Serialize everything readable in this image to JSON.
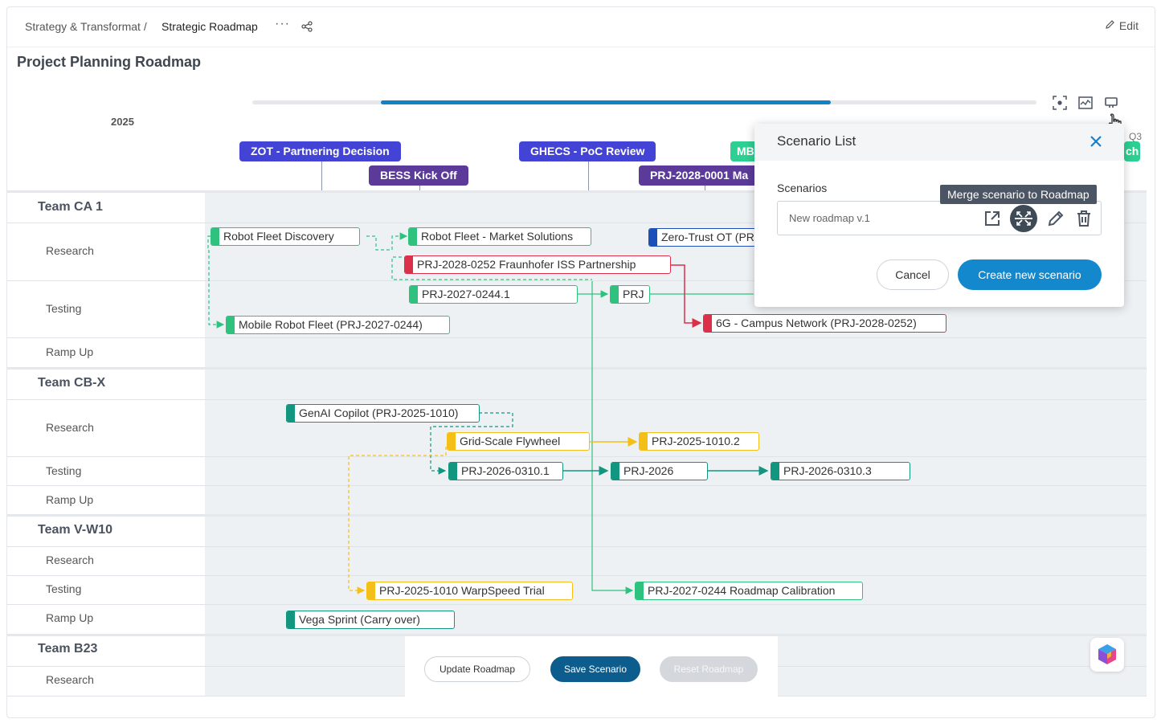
{
  "header": {
    "breadcrumb_parent": "Strategy & Transformat /",
    "breadcrumb_current": "Strategic Roadmap",
    "more_label": "···",
    "edit_label": "Edit"
  },
  "page_title": "Project Planning Roadmap",
  "timeline": {
    "year": "2025",
    "quarter_label": "Q3",
    "range_start_fraction": 0.16,
    "range_end_fraction": 0.737
  },
  "milestones": [
    {
      "label": "ZOT - Partnering Decision",
      "color": "#4343d6"
    },
    {
      "label": "BESS Kick Off",
      "color": "#5b3a9a"
    },
    {
      "label": "GHECS - PoC Review",
      "color": "#4343d6"
    },
    {
      "label": "PRJ-2028-0001 Ma",
      "color": "#5b3a9a"
    },
    {
      "label": "MB",
      "color": "#2ecf92"
    },
    {
      "label": "ch",
      "color": "#2ecf92"
    }
  ],
  "teams": [
    {
      "name": "Team CA 1",
      "lanes": [
        "Research",
        "Testing",
        "Ramp Up"
      ]
    },
    {
      "name": "Team CB-X",
      "lanes": [
        "Research",
        "Testing",
        "Ramp Up"
      ]
    },
    {
      "name": "Team V-W10",
      "lanes": [
        "Research",
        "Testing",
        "Ramp Up"
      ]
    },
    {
      "name": "Team B23",
      "lanes": [
        "Research"
      ]
    }
  ],
  "tasks": [
    {
      "label": "Robot Fleet Discovery",
      "color": "green"
    },
    {
      "label": "Robot Fleet - Market Solutions",
      "color": "green"
    },
    {
      "label": "Zero-Trust OT (PR",
      "color": "blue"
    },
    {
      "label": "PRJ-2028-0252 Fraunhofer ISS Partnership",
      "color": "red"
    },
    {
      "label": "PRJ-2027-0244.1",
      "color": "green"
    },
    {
      "label": "PRJ",
      "color": "green"
    },
    {
      "label": "Mobile Robot Fleet (PRJ-2027-0244)",
      "color": "green"
    },
    {
      "label": "6G - Campus Network (PRJ-2028-0252)",
      "color": "red"
    },
    {
      "label": "GenAI Copilot (PRJ-2025-1010)",
      "color": "teal"
    },
    {
      "label": "Grid-Scale Flywheel",
      "color": "yellow"
    },
    {
      "label": "PRJ-2025-1010.2",
      "color": "yellow"
    },
    {
      "label": "PRJ-2026-0310.1",
      "color": "teal"
    },
    {
      "label": "PRJ-2026",
      "color": "teal"
    },
    {
      "label": "PRJ-2026-0310.3",
      "color": "teal"
    },
    {
      "label": "PRJ-2025-1010 WarpSpeed Trial",
      "color": "yellow"
    },
    {
      "label": "PRJ-2027-0244 Roadmap Calibration",
      "color": "green"
    },
    {
      "label": "Vega Sprint (Carry over)",
      "color": "teal"
    }
  ],
  "bottom_bar": {
    "update_label": "Update Roadmap",
    "save_label": "Save Scenario",
    "reset_label": "Reset Roadmap"
  },
  "scenario_panel": {
    "title": "Scenario List",
    "scenarios_label": "Scenarios",
    "scenario_name": "New roadmap v.1",
    "tooltip": "Merge scenario to Roadmap",
    "cancel_label": "Cancel",
    "create_label": "Create new scenario"
  }
}
